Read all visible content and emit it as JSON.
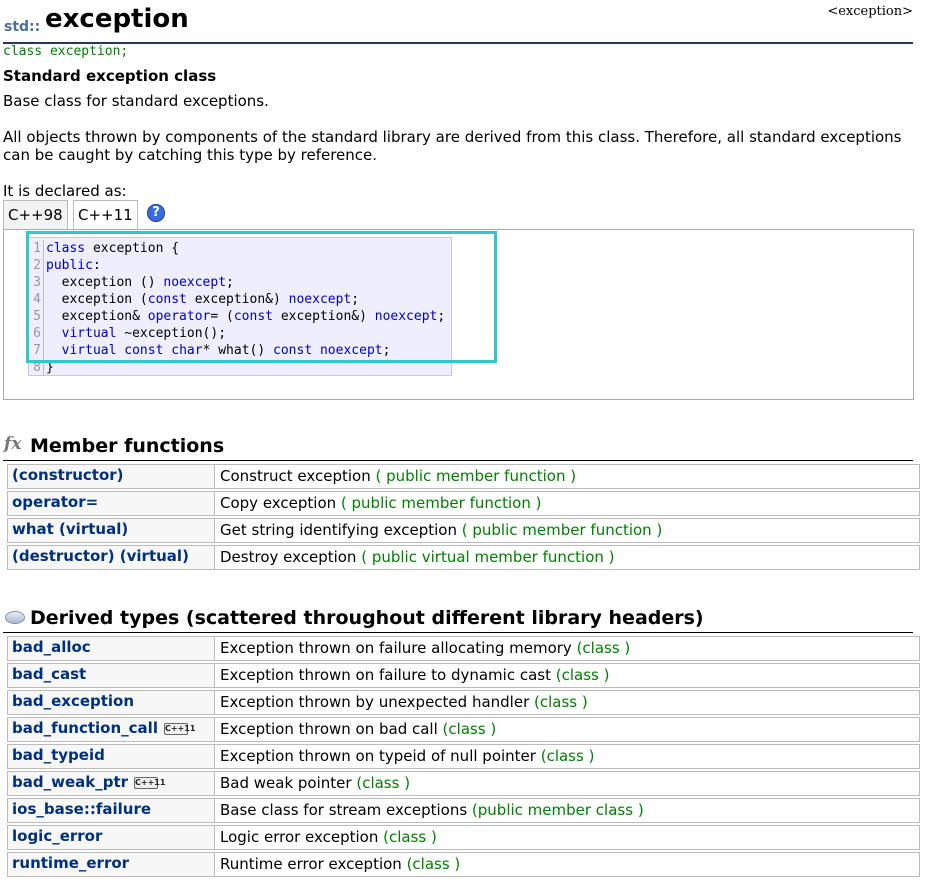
{
  "header": {
    "namespace": "std::",
    "title": "exception",
    "header_file": "<exception>"
  },
  "prototype": "class exception;",
  "subtitle": "Standard exception class",
  "intro": "Base class for standard exceptions.",
  "description": "All objects thrown by components of the standard library are derived from this class. Therefore, all standard exceptions can be caught by catching this type by reference.",
  "declared_as": "It is declared as:",
  "tabs": [
    "C++98",
    "C++11"
  ],
  "help_icon": "?",
  "code": {
    "line_numbers": [
      "1",
      "2",
      "3",
      "4",
      "5",
      "6",
      "7",
      "8"
    ],
    "lines": [
      [
        {
          "t": "class",
          "k": true
        },
        {
          "t": " exception {"
        }
      ],
      [
        {
          "t": "public",
          "k": true
        },
        {
          "t": ":"
        }
      ],
      [
        {
          "t": "  exception () "
        },
        {
          "t": "noexcept",
          "k": true
        },
        {
          "t": ";"
        }
      ],
      [
        {
          "t": "  exception ("
        },
        {
          "t": "const",
          "k": true
        },
        {
          "t": " exception&) "
        },
        {
          "t": "noexcept",
          "k": true
        },
        {
          "t": ";"
        }
      ],
      [
        {
          "t": "  exception& "
        },
        {
          "t": "operator",
          "k": true
        },
        {
          "t": "= ("
        },
        {
          "t": "const",
          "k": true
        },
        {
          "t": " exception&) "
        },
        {
          "t": "noexcept",
          "k": true
        },
        {
          "t": ";"
        }
      ],
      [
        {
          "t": "  "
        },
        {
          "t": "virtual",
          "k": true
        },
        {
          "t": " ~exception();"
        }
      ],
      [
        {
          "t": "  "
        },
        {
          "t": "virtual",
          "k": true
        },
        {
          "t": " "
        },
        {
          "t": "const",
          "k": true
        },
        {
          "t": " "
        },
        {
          "t": "char",
          "k": true
        },
        {
          "t": "* what() "
        },
        {
          "t": "const",
          "k": true
        },
        {
          "t": " "
        },
        {
          "t": "noexcept",
          "k": true
        },
        {
          "t": ";"
        }
      ],
      [
        {
          "t": "}"
        }
      ]
    ]
  },
  "member_functions": {
    "icon": "fx",
    "title": "Member functions",
    "rows": [
      {
        "name": "(constructor)",
        "desc": "Construct exception",
        "kind": "( public member function )"
      },
      {
        "name": "operator=",
        "desc": "Copy exception",
        "kind": "( public member function )"
      },
      {
        "name": "what (virtual)",
        "desc": "Get string identifying exception",
        "kind": "( public member function )"
      },
      {
        "name": "(destructor) (virtual)",
        "desc": "Destroy exception",
        "kind": "( public virtual member function )"
      }
    ]
  },
  "derived_types": {
    "title": "Derived types (scattered throughout different library headers)",
    "rows": [
      {
        "name": "bad_alloc",
        "desc": "Exception thrown on failure allocating memory",
        "kind": "(class )"
      },
      {
        "name": "bad_cast",
        "desc": "Exception thrown on failure to dynamic cast",
        "kind": "(class )"
      },
      {
        "name": "bad_exception",
        "desc": "Exception thrown by unexpected handler",
        "kind": "(class )"
      },
      {
        "name": "bad_function_call",
        "badge": "C++11",
        "desc": "Exception thrown on bad call",
        "kind": "(class )"
      },
      {
        "name": "bad_typeid",
        "desc": "Exception thrown on typeid of null pointer",
        "kind": "(class )"
      },
      {
        "name": "bad_weak_ptr",
        "badge": "C++11",
        "desc": "Bad weak pointer",
        "kind": "(class )"
      },
      {
        "name": "ios_base::failure",
        "desc": "Base class for stream exceptions",
        "kind": "(public member class )"
      },
      {
        "name": "logic_error",
        "desc": "Logic error exception",
        "kind": "(class )"
      },
      {
        "name": "runtime_error",
        "desc": "Runtime error exception",
        "kind": "(class )"
      }
    ]
  },
  "colors": {
    "link": "#003080",
    "kind": "#008000",
    "keyword": "#0000c8",
    "highlight": "#2ccacc"
  }
}
